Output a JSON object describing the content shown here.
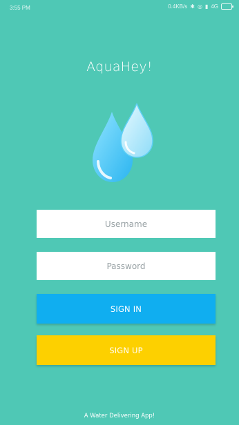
{
  "status_bar": {
    "time": "3:55 PM",
    "network_speed": "0.4KB/s",
    "signal_text": "4G"
  },
  "app": {
    "title": "AquaHey!",
    "tagline": "A Water Delivering App!"
  },
  "form": {
    "username_placeholder": "Username",
    "password_placeholder": "Password",
    "signin_label": "SIGN IN",
    "signup_label": "SIGN UP"
  },
  "colors": {
    "background": "#4fc8b5",
    "signin": "#10aef0",
    "signup": "#fdd000"
  },
  "icons": [
    "water-drops-logo-icon",
    "bluetooth-icon",
    "alarm-icon",
    "signal-icon",
    "battery-icon"
  ]
}
